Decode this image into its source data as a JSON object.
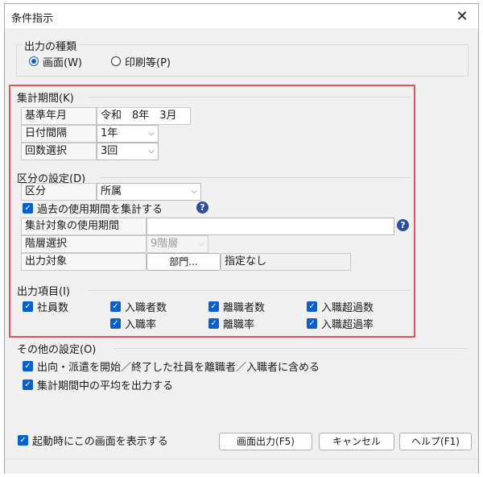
{
  "window": {
    "title": "条件指示",
    "close_glyph": "✕"
  },
  "output_type": {
    "title": "出力の種類",
    "options": [
      {
        "label": "画面(W)",
        "checked": true
      },
      {
        "label": "印刷等(P)",
        "checked": false
      }
    ]
  },
  "period": {
    "title": "集計期間(K)",
    "rows": [
      {
        "label": "基準年月",
        "value": "令和　8年　3月"
      },
      {
        "label": "日付間隔",
        "value": "1年"
      },
      {
        "label": "回数選択",
        "value": "3回"
      }
    ]
  },
  "division": {
    "title": "区分の設定(D)",
    "kubun_label": "区分",
    "kubun_value": "所属",
    "past_usage_label": "過去の使用期間を集計する",
    "usage_period_label": "集計対象の使用期間",
    "usage_period_value": "",
    "hierarchy_label": "階層選択",
    "hierarchy_value": "9階層",
    "output_target_label": "出力対象",
    "dept_button": "部門...",
    "dept_value": "指定なし"
  },
  "output_items": {
    "title": "出力項目(I)",
    "items": [
      {
        "label": "社員数",
        "checked": true
      },
      {
        "label": "入職者数",
        "checked": true
      },
      {
        "label": "離職者数",
        "checked": true
      },
      {
        "label": "入職超過数",
        "checked": true
      },
      {
        "label": "入職率",
        "checked": true
      },
      {
        "label": "離職率",
        "checked": true
      },
      {
        "label": "入職超過率",
        "checked": true
      }
    ]
  },
  "other": {
    "title": "その他の設定(O)",
    "options": [
      {
        "label": "出向・派遣を開始／終了した社員を離職者／入職者に含める",
        "checked": true
      },
      {
        "label": "集計期間中の平均を出力する",
        "checked": true
      }
    ]
  },
  "footer": {
    "startup_label": "起動時にこの画面を表示する",
    "screen_output_button": "画面出力(F5)",
    "cancel_button": "キャンセル",
    "help_button": "ヘルプ(F1)"
  },
  "icons": {
    "help": "question-circle-icon",
    "check": "checkmark-icon",
    "dropdown": "chevron-down-icon"
  },
  "colors": {
    "accent": "#0a5fc8",
    "highlight": "#e25560",
    "help": "#2b4f9e"
  }
}
